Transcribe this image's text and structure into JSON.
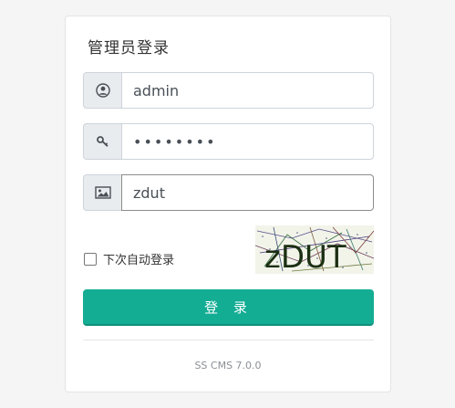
{
  "login": {
    "title": "管理员登录",
    "username": {
      "value": "admin",
      "icon": "user-circle-icon"
    },
    "password": {
      "value": "••••••••",
      "icon": "key-icon"
    },
    "captcha": {
      "value": "zdut",
      "icon": "image-icon",
      "image_text": "zDUT"
    },
    "remember_label": "下次自动登录",
    "submit_label": "登 录",
    "version": "SS CMS 7.0.0"
  },
  "colors": {
    "accent": "#13ad94",
    "addon_bg": "#e9ecef",
    "border": "#ced4da"
  }
}
